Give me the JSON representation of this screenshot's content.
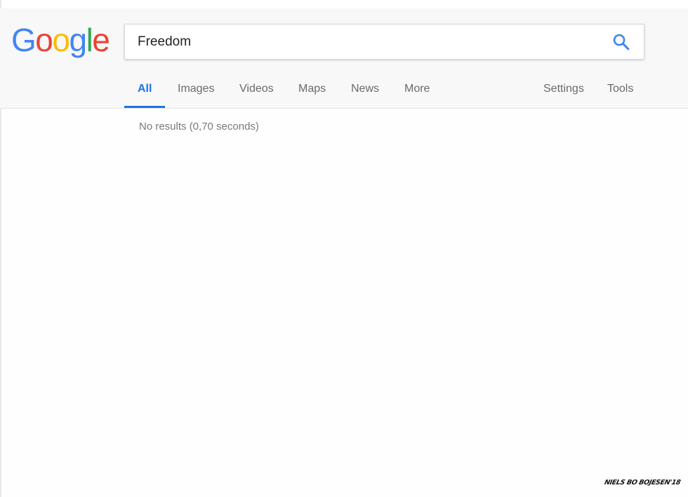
{
  "logo": {
    "letters": [
      {
        "char": "G",
        "color": "#4285f4"
      },
      {
        "char": "o",
        "color": "#ea4335"
      },
      {
        "char": "o",
        "color": "#fbbc05"
      },
      {
        "char": "g",
        "color": "#4285f4"
      },
      {
        "char": "l",
        "color": "#34a853"
      },
      {
        "char": "e",
        "color": "#ea4335"
      }
    ]
  },
  "search": {
    "value": "Freedom",
    "icon": "search-icon",
    "icon_color": "#4285f4"
  },
  "tabs": [
    {
      "label": "All",
      "active": true
    },
    {
      "label": "Images",
      "active": false
    },
    {
      "label": "Videos",
      "active": false
    },
    {
      "label": "Maps",
      "active": false
    },
    {
      "label": "News",
      "active": false
    },
    {
      "label": "More",
      "active": false
    }
  ],
  "tools_tabs": [
    {
      "label": "Settings"
    },
    {
      "label": "Tools"
    }
  ],
  "results": {
    "stats": "No results (0,70 seconds)"
  },
  "signature": "NIELS BO BOJESEN'18",
  "colors": {
    "accent": "#1a73e8",
    "header_bg": "#f8f8f8",
    "tab_text": "#6a6a6a"
  }
}
